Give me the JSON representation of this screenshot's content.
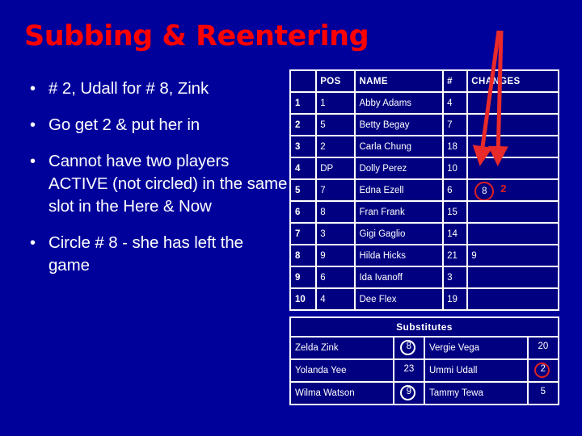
{
  "slide": {
    "title": "Subbing & Reentering",
    "background_color": "#00009B",
    "title_color": "#FF0000",
    "text_color": "#FFFFFF",
    "accent_color": "#E02020"
  },
  "bullets": [
    {
      "marker": "•",
      "text": "# 2, Udall for # 8, Zink"
    },
    {
      "marker": "•",
      "text": "Go get 2 & put her in"
    },
    {
      "marker": "•",
      "text": "Cannot have two players ACTIVE (not circled) in the same slot in the Here & Now"
    },
    {
      "marker": "•",
      "text": "Circle # 8 - she has left the game"
    }
  ],
  "roster": {
    "headers": {
      "slot": "",
      "pos": "POS",
      "name": "NAME",
      "num": "#",
      "changes": "CHANGES"
    },
    "rows": [
      {
        "slot": "1",
        "pos": "1",
        "name": "Abby Adams",
        "num": "4",
        "changes": ""
      },
      {
        "slot": "2",
        "pos": "5",
        "name": "Betty Begay",
        "num": "7",
        "changes": ""
      },
      {
        "slot": "3",
        "pos": "2",
        "name": "Carla Chung",
        "num": "18",
        "changes": ""
      },
      {
        "slot": "4",
        "pos": "DP",
        "name": "Dolly Perez",
        "num": "10",
        "changes": ""
      },
      {
        "slot": "5",
        "pos": "7",
        "name": "Edna Ezell",
        "num": "6",
        "changes": "8",
        "changes_circled": "8",
        "changes_extra": "2"
      },
      {
        "slot": "6",
        "pos": "8",
        "name": "Fran Frank",
        "num": "15",
        "changes": ""
      },
      {
        "slot": "7",
        "pos": "3",
        "name": "Gigi Gaglio",
        "num": "14",
        "changes": ""
      },
      {
        "slot": "8",
        "pos": "9",
        "name": "Hilda Hicks",
        "num": "21",
        "changes": "9"
      },
      {
        "slot": "9",
        "pos": "6",
        "name": "Ida Ivanoff",
        "num": "3",
        "changes": ""
      },
      {
        "slot": "10",
        "pos": "4",
        "name": "Dee Flex",
        "num": "19",
        "changes": ""
      }
    ]
  },
  "substitutes": {
    "header": "Substitutes",
    "rows": [
      {
        "left_name": "Zelda Zink",
        "left_num": "8",
        "left_circle": "white",
        "right_name": "Vergie Vega",
        "right_num": "20",
        "right_circle": "none"
      },
      {
        "left_name": "Yolanda Yee",
        "left_num": "23",
        "left_circle": "none",
        "right_name": "Ummi Udall",
        "right_num": "2",
        "right_circle": "red"
      },
      {
        "left_name": "Wilma Watson",
        "left_num": "9",
        "left_circle": "white",
        "right_name": "Tammy Tewa",
        "right_num": "5",
        "right_circle": "none"
      }
    ]
  },
  "annotations": {
    "arrow_color": "#E02020",
    "arrow_count": "2",
    "arrow_target": "CHANGES cell of slot 5"
  }
}
